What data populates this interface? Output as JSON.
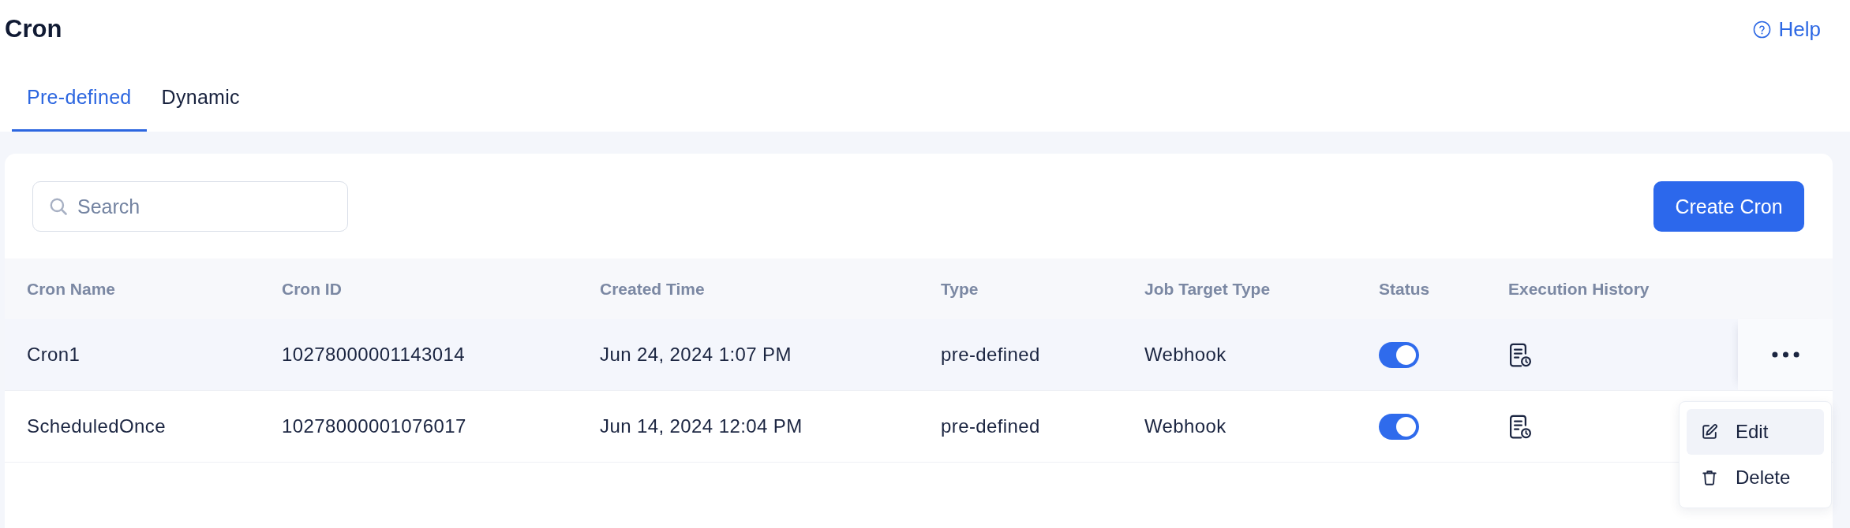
{
  "page": {
    "title": "Cron",
    "help_link": "Help"
  },
  "tabs": [
    {
      "label": "Pre-defined",
      "selected": true
    },
    {
      "label": "Dynamic",
      "selected": false
    }
  ],
  "toolbar": {
    "search": {
      "placeholder": "Search"
    },
    "create_button": "Create Cron"
  },
  "table": {
    "columns": [
      "Cron Name",
      "Cron ID",
      "Created Time",
      "Type",
      "Job Target Type",
      "Status",
      "Execution History"
    ],
    "rows": [
      {
        "cells": [
          "Cron1",
          "10278000001143014",
          "Jun 24, 2024 1:07 PM",
          "pre-defined",
          "Webhook"
        ],
        "status_on": true,
        "selected": true
      },
      {
        "cells": [
          "ScheduledOnce",
          "10278000001076017",
          "Jun 14, 2024 12:04 PM",
          "pre-defined",
          "Webhook"
        ],
        "status_on": true,
        "selected": false
      }
    ]
  },
  "row_menu": {
    "items": [
      {
        "kind": "edit",
        "label": "Edit",
        "selected": true
      },
      {
        "kind": "delete",
        "label": "Delete",
        "selected": false
      }
    ]
  }
}
